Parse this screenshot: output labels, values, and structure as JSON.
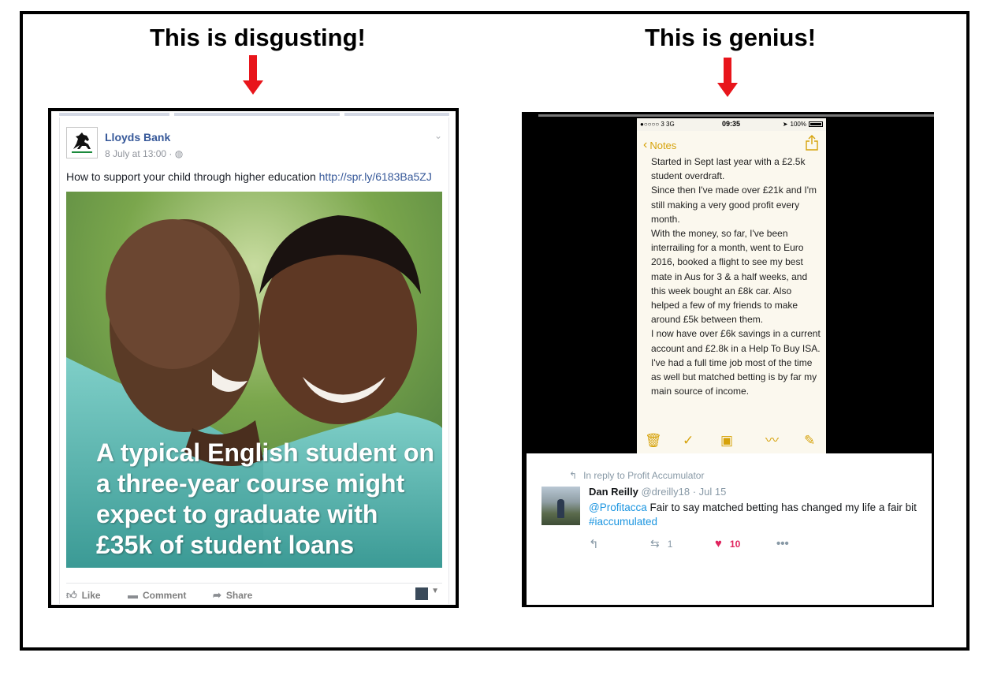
{
  "headings": {
    "left": "This is disgusting!",
    "right": "This is genius!"
  },
  "accent_colors": {
    "arrow": "#e8151b",
    "facebook_link": "#365899",
    "notes_yellow": "#d6a20a",
    "twitter_link": "#1b95e0",
    "twitter_like": "#e0245e"
  },
  "facebook_post": {
    "page_name": "Lloyds Bank",
    "timestamp": "8 July at 13:00",
    "privacy_icon": "globe-icon",
    "text": "How to support your child through higher education",
    "link": "http://spr.ly/6183Ba5ZJ",
    "image_caption": "A typical English student on a three-year course might expect to graduate with £35k of student loans",
    "actions": {
      "like": "Like",
      "comment": "Comment",
      "share": "Share"
    }
  },
  "phone_notes": {
    "status_left": "●○○○○ 3  3G",
    "status_time": "09:35",
    "status_right": "100%",
    "back_label": "Notes",
    "lines": [
      "Started in Sept last year with a £2.5k student overdraft.",
      "Since then I've made over £21k and I'm still making a very good profit every month.",
      "With the money, so far, I've been interrailing for a month, went to Euro 2016, booked a flight to see my best mate in Aus for 3 & a half weeks, and this week bought an £8k car. Also helped a few of my friends to make around £5k between them.",
      "I now have over £6k savings in a current account and £2.8k in a Help To Buy ISA. I've had a full time job most of the time as well but matched betting is by far my main source of income."
    ],
    "toolbar_icons": [
      "trash-icon",
      "checkmark-icon",
      "camera-icon",
      "sketch-icon",
      "compose-icon"
    ]
  },
  "tweet": {
    "reply_to": "In reply to Profit Accumulator",
    "name": "Dan Reilly",
    "handle": "@dreilly18",
    "date": "· Jul 15",
    "mention": "@Profitacca",
    "text": "Fair to say matched betting has changed my life a fair bit",
    "hashtag": "#iaccumulated",
    "retweets": "1",
    "likes": "10"
  }
}
